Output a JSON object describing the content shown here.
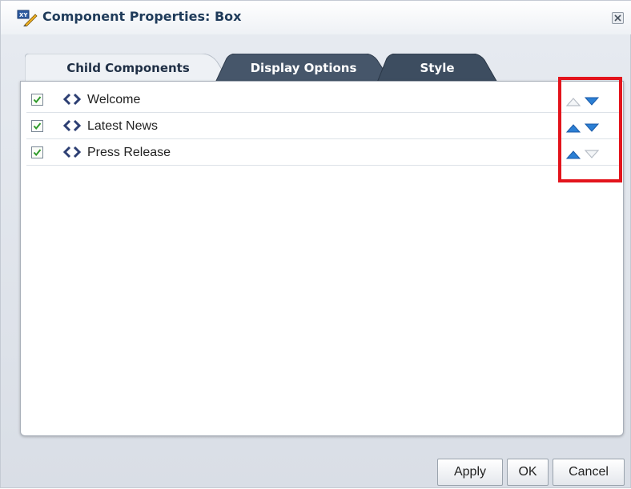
{
  "dialog": {
    "title": "Component Properties: Box",
    "title_icon": "edit-properties-icon",
    "close_icon": "close-icon"
  },
  "tabs": [
    {
      "label": "Child Components",
      "active": true
    },
    {
      "label": "Display Options",
      "active": false
    },
    {
      "label": "Style",
      "active": false
    }
  ],
  "child_components": [
    {
      "label": "Welcome",
      "checked": true,
      "icon": "code-brackets-icon",
      "move_up_enabled": false,
      "move_down_enabled": true
    },
    {
      "label": "Latest News",
      "checked": true,
      "icon": "code-brackets-icon",
      "move_up_enabled": true,
      "move_down_enabled": true
    },
    {
      "label": "Press Release",
      "checked": true,
      "icon": "code-brackets-icon",
      "move_up_enabled": true,
      "move_down_enabled": false
    }
  ],
  "buttons": {
    "apply": "Apply",
    "ok": "OK",
    "cancel": "Cancel"
  },
  "colors": {
    "title_text": "#1f3b5a",
    "active_tab_bg": "#eef1f5",
    "inactive_tab_bg": "#3d4d60",
    "arrow_enabled": "#2b7fd4",
    "arrow_disabled": "#b8bec6",
    "checkbox_mark": "#2f9a2a",
    "highlight": "#e3141c"
  }
}
